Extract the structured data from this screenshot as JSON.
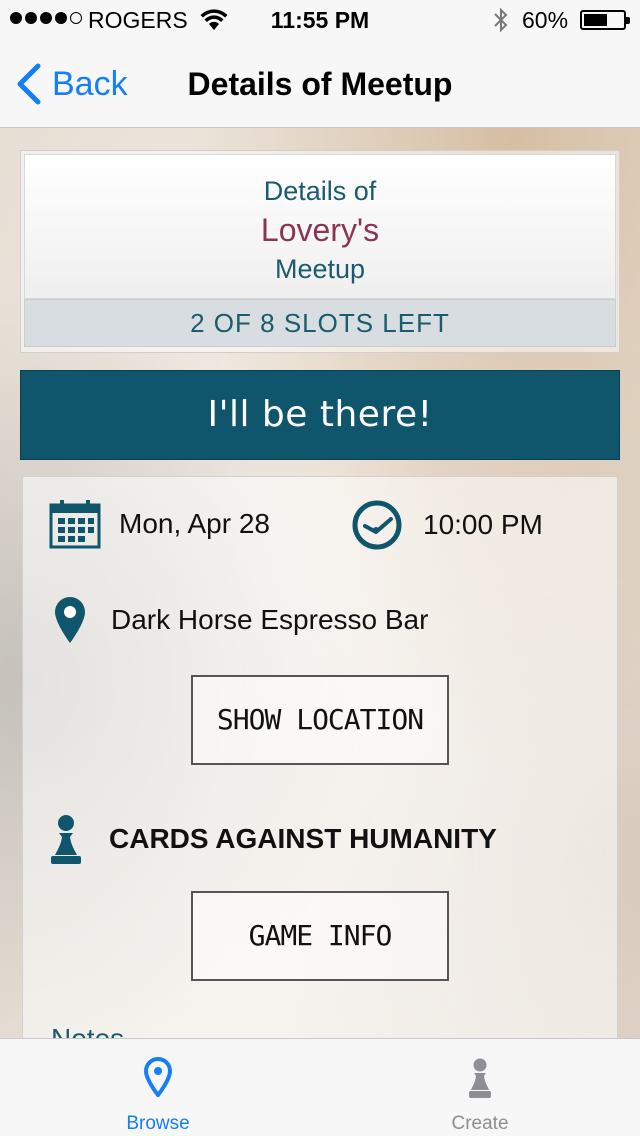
{
  "status_bar": {
    "carrier": "ROGERS",
    "time": "11:55 PM",
    "battery_percent": "60%",
    "battery_level": 0.6,
    "signal_bars": 4
  },
  "nav": {
    "back_label": "Back",
    "title": "Details of Meetup"
  },
  "header": {
    "line1": "Details of",
    "host_name": "Lovery's",
    "line3": "Meetup",
    "slots": "2 OF 8 SLOTS LEFT"
  },
  "cta_label": "I'll be there!",
  "details": {
    "date": "Mon, Apr 28",
    "time": "10:00 PM",
    "location": "Dark Horse Espresso Bar",
    "show_location_label": "SHOW LOCATION",
    "game": "CARDS AGAINST HUMANITY",
    "game_info_label": "GAME INFO",
    "notes_label": "Notes"
  },
  "tabs": [
    {
      "label": "Browse",
      "icon": "map-pin-icon",
      "selected": true
    },
    {
      "label": "Create",
      "icon": "pawn-icon",
      "selected": false
    }
  ],
  "colors": {
    "accent": "#157efb",
    "brand_teal": "#0f566c",
    "host_name": "#8b3550"
  }
}
